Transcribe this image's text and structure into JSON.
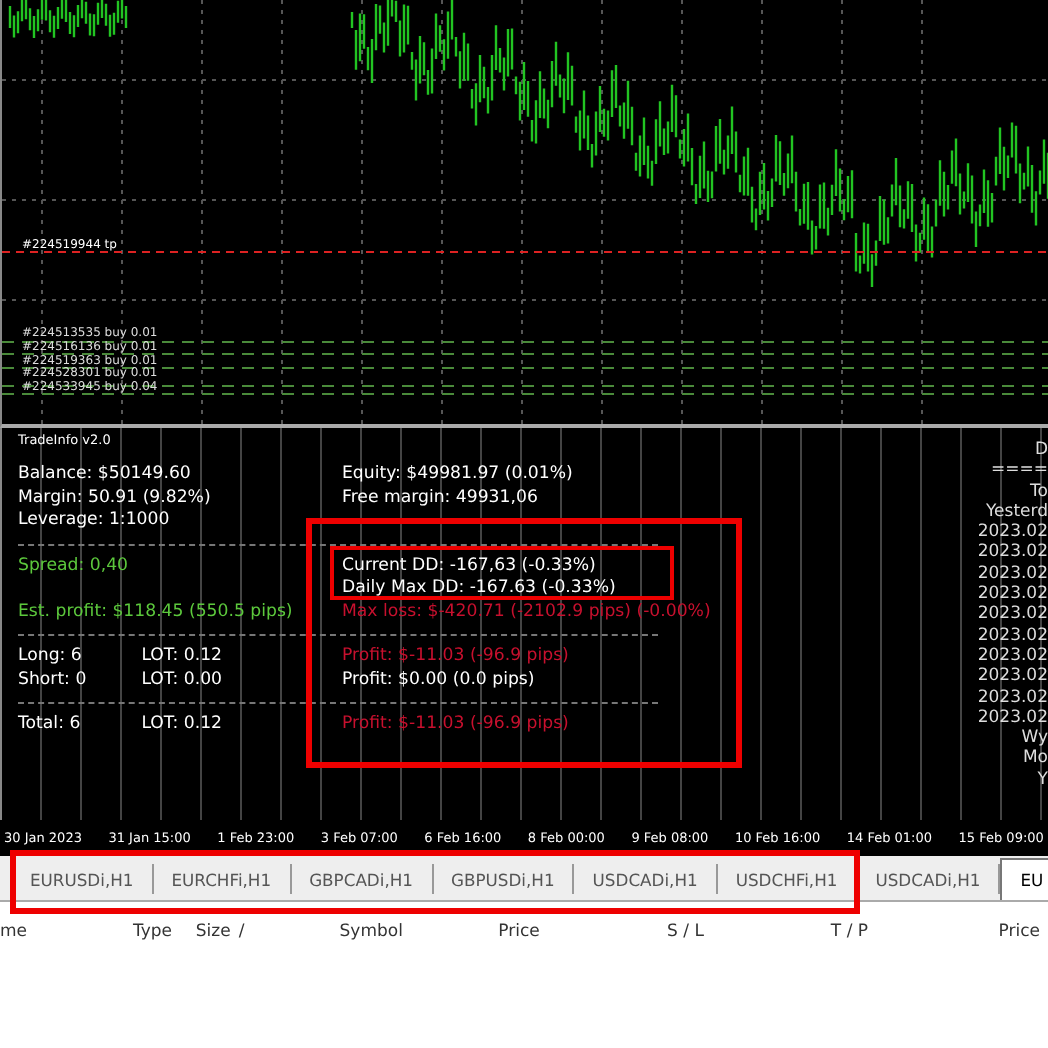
{
  "chart": {
    "tp_label": "#224519944 tp",
    "orders": [
      "#224513535 buy 0.01",
      "#224516136 buy 0.01",
      "#224519363 buy 0.01",
      "#224528301 buy 0.01",
      "#224533945 buy 0.04"
    ]
  },
  "trade_info": {
    "title": "TradeInfo v2.0",
    "rows": [
      {
        "left": {
          "text": "Balance:  $50149.60",
          "color": "#ffffff"
        },
        "middle": {
          "text": "Equity:  $49981.97  (0.01%)",
          "color": "#ffffff"
        }
      },
      {
        "left": {
          "text": "Margin: 50.91  (9.82%)",
          "color": "#ffffff"
        },
        "middle": {
          "text": "Free margin: 49931,06",
          "color": "#ffffff"
        }
      },
      {
        "left": {
          "text": "Leverage: 1:1000",
          "color": "#ffffff"
        },
        "divider": true
      },
      {
        "left": {
          "text": "Spread: 0,40",
          "color": "#5cc83c"
        },
        "middle": {
          "text": "Current   DD: -167,63   (-0.33%)",
          "color": "#ffffff"
        }
      },
      {
        "middle": {
          "text": "Daily Max DD: -167.63   (-0.33%)",
          "color": "#ffffff"
        }
      },
      {
        "left": {
          "text": "Est. profit: $118.45  (550.5 pips)",
          "color": "#5cc83c"
        },
        "middle": {
          "text": "Max loss: $-420.71  (-2102.9 pips)  (-0.00%)",
          "color": "#c8102e"
        },
        "divider": true
      },
      {
        "left": {
          "text": "Long:  6",
          "color": "#ffffff"
        },
        "lot": "LOT: 0.12",
        "middle": {
          "text": "Profit: $-11.03   (-96.9 pips)",
          "color": "#c8102e"
        }
      },
      {
        "left": {
          "text": "Short:  0",
          "color": "#ffffff"
        },
        "lot": "LOT: 0.00",
        "middle": {
          "text": "Profit: $0.00   (0.0 pips)",
          "color": "#ffffff"
        },
        "divider": true
      },
      {
        "left": {
          "text": "Total:  6",
          "color": "#ffffff"
        },
        "lot": "LOT: 0.12",
        "middle": {
          "text": "Profit: $-11.03   (-96.9 pips)",
          "color": "#c8102e"
        }
      }
    ],
    "side": [
      "D",
      "====",
      "To",
      "Yesterd",
      "2023.02",
      "2023.02",
      "2023.02",
      "2023.02",
      "2023.02",
      "2023.02",
      "2023.02",
      "2023.02",
      "2023.02",
      "2023.02",
      "Wy",
      "Mo",
      "Y"
    ]
  },
  "time_axis": [
    "30 Jan 2023",
    "31 Jan 15:00",
    "1 Feb 23:00",
    "3 Feb 07:00",
    "6 Feb 16:00",
    "8 Feb 00:00",
    "9 Feb 08:00",
    "10 Feb 16:00",
    "14 Feb 01:00",
    "15 Feb 09:00"
  ],
  "tabs": [
    {
      "label": "EURUSDi,H1",
      "selected": false
    },
    {
      "label": "EURCHFi,H1",
      "selected": false
    },
    {
      "label": "GBPCADi,H1",
      "selected": false
    },
    {
      "label": "GBPUSDi,H1",
      "selected": false
    },
    {
      "label": "USDCADi,H1",
      "selected": false
    },
    {
      "label": "USDCHFi,H1",
      "selected": false
    },
    {
      "label": "USDCADi,H1",
      "selected": false
    },
    {
      "label": "EU",
      "selected": true
    }
  ],
  "columns": [
    "me",
    "Type",
    "Size",
    "/",
    "Symbol",
    "Price",
    "S / L",
    "T / P",
    "Price"
  ]
}
